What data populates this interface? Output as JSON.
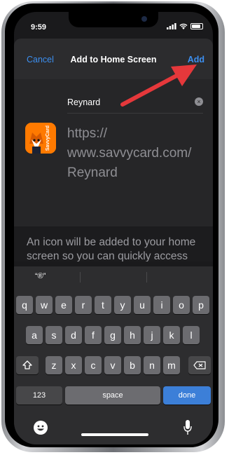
{
  "status_bar": {
    "time": "9:59"
  },
  "nav": {
    "cancel_label": "Cancel",
    "title": "Add to Home Screen",
    "add_label": "Add"
  },
  "form": {
    "name_value": "Reynard",
    "url_lines": [
      "https://",
      "www.savvycard.com/",
      "Reynard"
    ],
    "icon_brand_text": "SavvyCard"
  },
  "info": {
    "text": "An icon will be added to your home screen so you can quickly access this website."
  },
  "keyboard": {
    "suggestion": "“®”",
    "row1": [
      "q",
      "w",
      "e",
      "r",
      "t",
      "y",
      "u",
      "i",
      "o",
      "p"
    ],
    "row2": [
      "a",
      "s",
      "d",
      "f",
      "g",
      "h",
      "j",
      "k",
      "l"
    ],
    "row3": [
      "z",
      "x",
      "c",
      "v",
      "b",
      "n",
      "m"
    ],
    "numbers_label": "123",
    "space_label": "space",
    "done_label": "done"
  },
  "colors": {
    "accent": "#3c8ff0",
    "arrow": "#e5383b",
    "icon_bg": "#ff7a00",
    "done_key": "#3c7fd8"
  }
}
